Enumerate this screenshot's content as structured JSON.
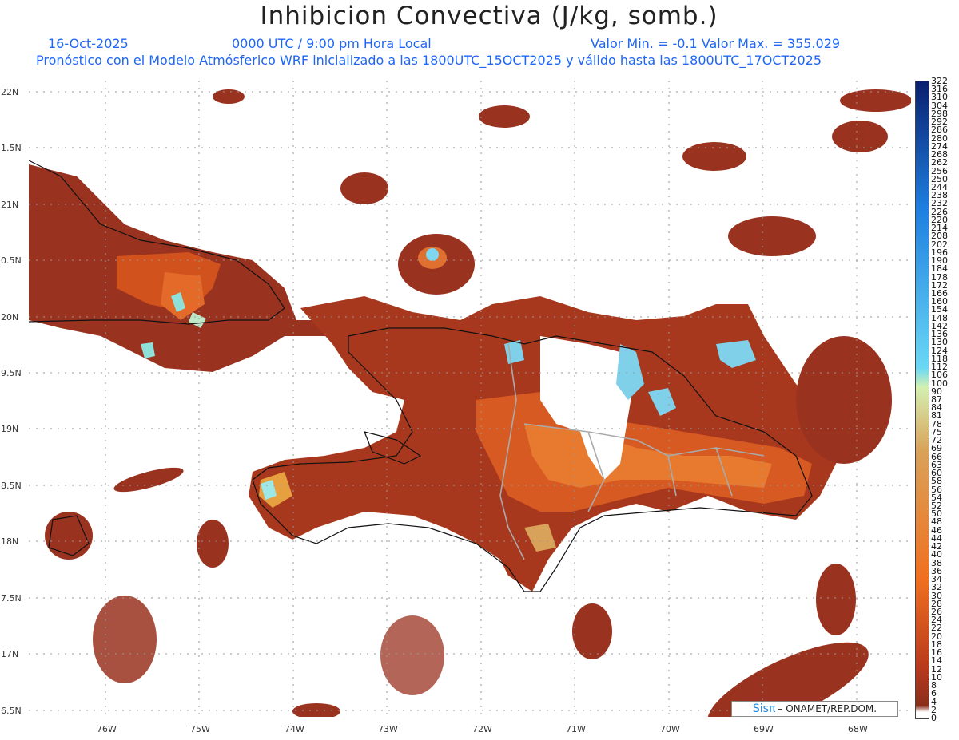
{
  "title": "Inhibicion Convectiva (J/kg, somb.)",
  "header": {
    "date": "16-Oct-2025",
    "time": "0000 UTC / 9:00 pm Hora Local",
    "minmax": "Valor Min. = -0.1  Valor Max. = 355.029",
    "model_info": "Pronóstico con el Modelo Atmósferico WRF inicializado a las 1800UTC_15OCT2025 y válido hasta las  1800UTC_17OCT2025"
  },
  "map": {
    "lat_labels": [
      "22N",
      "1.5N",
      "21N",
      "0.5N",
      "20N",
      "9.5N",
      "19N",
      "8.5N",
      "18N",
      "7.5N",
      "17N",
      "6.5N"
    ],
    "lon_labels": [
      "76W",
      "75W",
      "74W",
      "73W",
      "72W",
      "71W",
      "70W",
      "69W",
      "68W"
    ]
  },
  "colorbar": {
    "labels": [
      "322",
      "316",
      "310",
      "304",
      "298",
      "292",
      "286",
      "280",
      "274",
      "268",
      "262",
      "256",
      "250",
      "244",
      "238",
      "232",
      "226",
      "220",
      "214",
      "208",
      "202",
      "196",
      "190",
      "184",
      "178",
      "172",
      "166",
      "160",
      "154",
      "148",
      "142",
      "136",
      "130",
      "124",
      "118",
      "112",
      "106",
      "100",
      "90",
      "87",
      "84",
      "81",
      "78",
      "75",
      "72",
      "69",
      "66",
      "63",
      "60",
      "58",
      "56",
      "54",
      "52",
      "50",
      "48",
      "46",
      "44",
      "42",
      "40",
      "38",
      "36",
      "34",
      "32",
      "30",
      "28",
      "26",
      "24",
      "22",
      "20",
      "18",
      "16",
      "14",
      "12",
      "10",
      "8",
      "6",
      "4",
      "2",
      "0"
    ],
    "colors": {
      "high": "#0a1f6e",
      "mid_blue": "#1e7fe0",
      "cyan": "#6ad8f5",
      "light_green": "#d4f0b0",
      "tan": "#d9a25a",
      "orange": "#f07020",
      "red_brown": "#b83a1c",
      "dark": "#8a2e1a"
    }
  },
  "credit": {
    "brand": "Sisπ",
    "text": "– ONAMET/REP.DOM."
  }
}
